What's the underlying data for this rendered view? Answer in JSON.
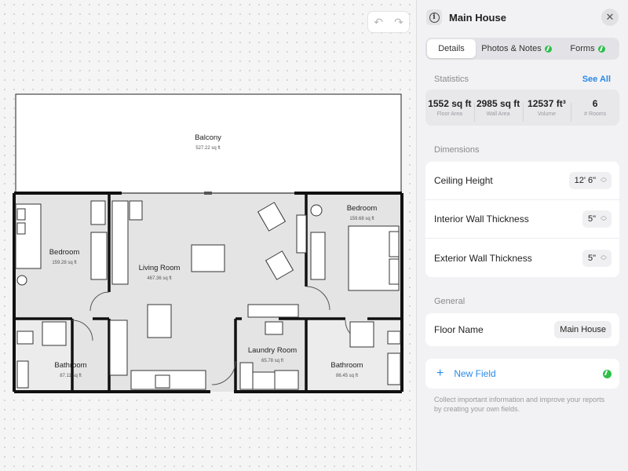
{
  "toolbar": {
    "undo_icon": "undo-arrow-icon",
    "redo_icon": "redo-arrow-icon"
  },
  "plan": {
    "rooms": [
      {
        "name": "Balcony",
        "area": "527.22 sq ft"
      },
      {
        "name": "Bedroom",
        "area": "159.28 sq ft"
      },
      {
        "name": "Living Room",
        "area": "467.36 sq ft"
      },
      {
        "name": "Bedroom",
        "area": "159.68 sq ft"
      },
      {
        "name": "Bathroom",
        "area": "87.11 sq ft"
      },
      {
        "name": "Laundry Room",
        "area": "65.78 sq ft"
      },
      {
        "name": "Bathroom",
        "area": "86.45 sq ft"
      }
    ]
  },
  "panel": {
    "title": "Main House",
    "tabs": [
      {
        "label": "Details",
        "active": true
      },
      {
        "label": "Photos & Notes",
        "active": false
      },
      {
        "label": "Forms",
        "active": false
      }
    ],
    "statistics": {
      "title": "Statistics",
      "see_all": "See All",
      "items": [
        {
          "value": "1552 sq ft",
          "label": "Floor Area"
        },
        {
          "value": "2985 sq ft",
          "label": "Wall Area"
        },
        {
          "value": "12537 ft³",
          "label": "Volume"
        },
        {
          "value": "6",
          "label": "# Rooms"
        }
      ]
    },
    "dimensions": {
      "title": "Dimensions",
      "rows": [
        {
          "label": "Ceiling Height",
          "value": "12' 6\""
        },
        {
          "label": "Interior Wall Thickness",
          "value": "5\""
        },
        {
          "label": "Exterior Wall Thickness",
          "value": "5\""
        }
      ]
    },
    "general": {
      "title": "General",
      "floor_name_label": "Floor Name",
      "floor_name_value": "Main House"
    },
    "new_field": {
      "label": "New Field",
      "help": "Collect important information and improve your reports by creating your own fields."
    }
  },
  "colors": {
    "accent": "#2a8ae8",
    "badge": "#2fbf4a"
  }
}
